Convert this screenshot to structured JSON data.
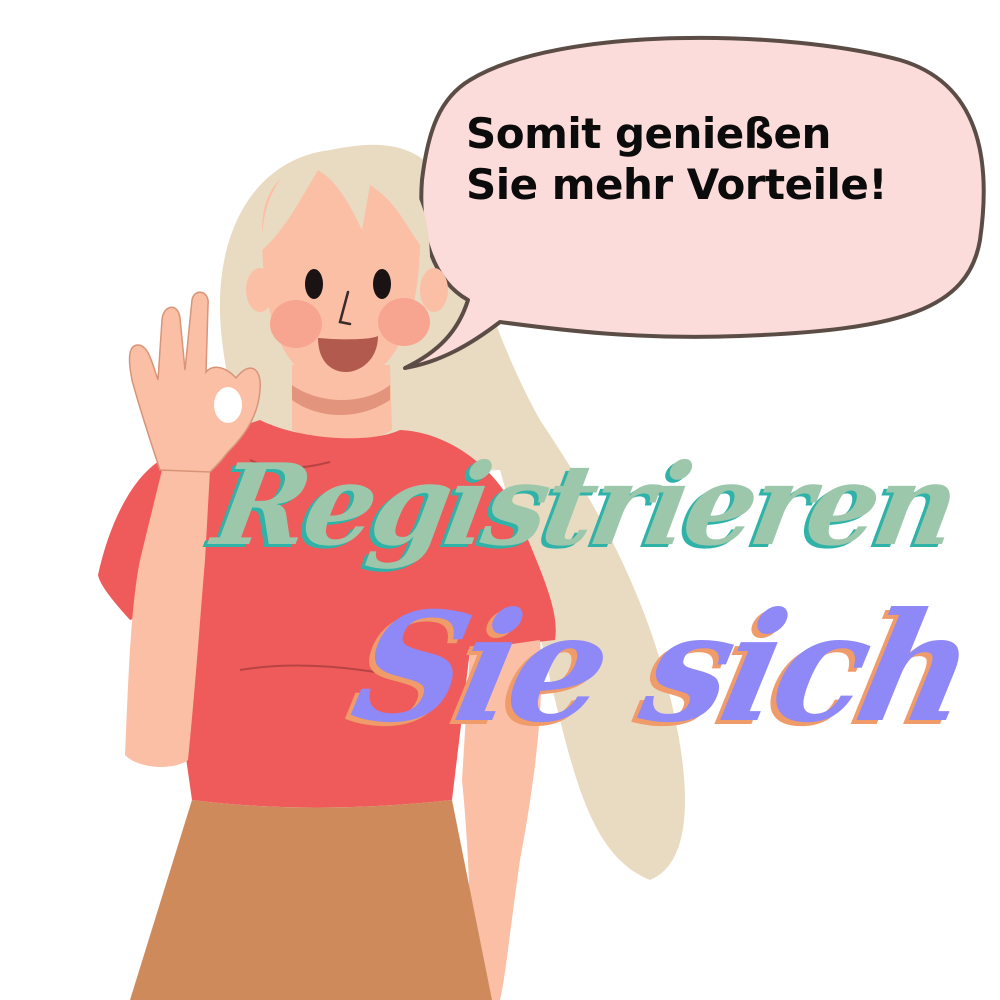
{
  "speech_bubble": {
    "line1": "Somit genießen",
    "line2": "Sie mehr Vorteile!"
  },
  "headline": {
    "word1": "Registrieren",
    "word2": "Sie sich"
  },
  "colors": {
    "background": "#ffffff",
    "bubble_fill": "#fcdcda",
    "bubble_outline": "#5b4d46",
    "hair": "#e9dbc2",
    "skin": "#fbbfa5",
    "blush": "#f7a590",
    "shirt": "#ef5b5b",
    "skirt": "#cf8a5c",
    "headline_word1": "#9dc7ab",
    "headline_word1_shadow": "#2fb3a8",
    "headline_word2": "#8f88f7",
    "headline_word2_shadow": "#ef9b6a",
    "text": "#0b0b0b"
  }
}
